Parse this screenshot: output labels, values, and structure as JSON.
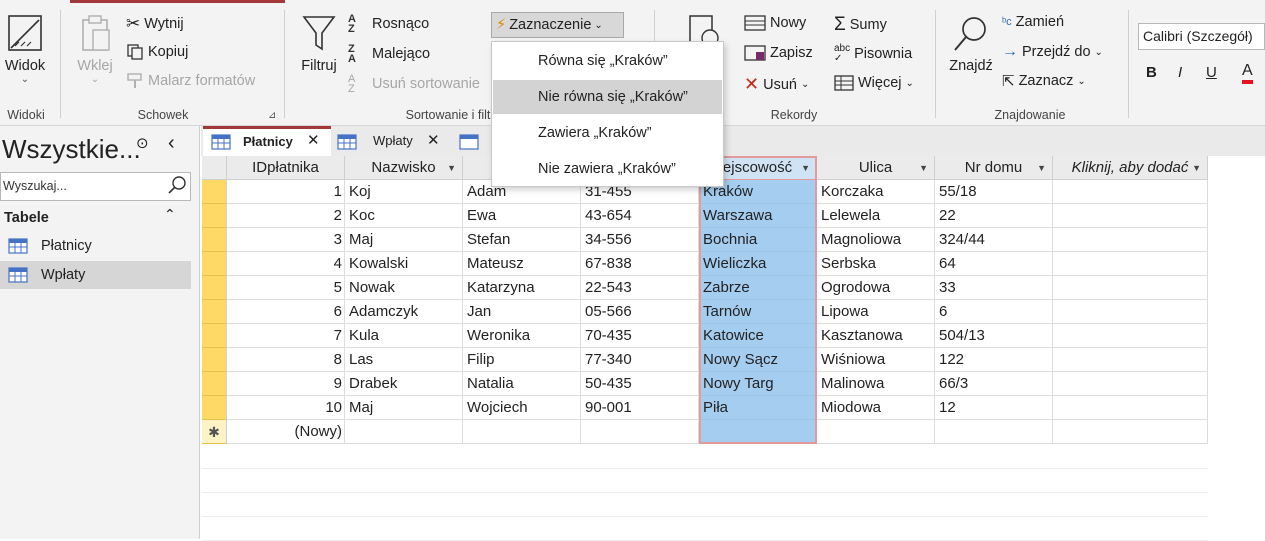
{
  "ribbon": {
    "widoki": {
      "label": "Widok",
      "group": "Widoki"
    },
    "schowek": {
      "paste": "Wklej",
      "cut": "Wytnij",
      "copy": "Kopiuj",
      "format_painter": "Malarz formatów",
      "group": "Schowek"
    },
    "sort": {
      "filter": "Filtruj",
      "asc": "Rosnąco",
      "desc": "Malejąco",
      "remove": "Usuń sortowanie",
      "selection": "Zaznaczenie",
      "group": "Sortowanie i filt"
    },
    "records": {
      "new": "Nowy",
      "save": "Zapisz",
      "delete": "Usuń",
      "totals": "Sumy",
      "spelling": "Pisownia",
      "more": "Więcej",
      "group": "Rekordy"
    },
    "find": {
      "find": "Znajdź",
      "replace": "Zamień",
      "goto": "Przejdź do",
      "select": "Zaznacz",
      "group": "Znajdowanie"
    },
    "font": {
      "name": "Calibri (Szczegół)",
      "bold": "B",
      "italic": "I",
      "underline": "U",
      "color": "A"
    }
  },
  "dropdown": {
    "items": [
      "Równa się „Kraków”",
      "Nie równa się „Kraków”",
      "Zawiera „Kraków”",
      "Nie zawiera „Kraków”"
    ]
  },
  "nav": {
    "title": "Wszystkie...",
    "search_placeholder": "Wyszukaj...",
    "section": "Tabele",
    "items": [
      "Płatnicy",
      "Wpłaty"
    ]
  },
  "tabs": [
    "Płatnicy",
    "Wpłaty"
  ],
  "table": {
    "headers": [
      "IDpłatnika",
      "Nazwisko",
      "",
      "",
      "ejscowość",
      "Ulica",
      "Nr domu",
      "Kliknij, aby dodać"
    ],
    "rows": [
      [
        "1",
        "Koj",
        "Adam",
        "31-455",
        "Kraków",
        "Korczaka",
        "55/18"
      ],
      [
        "2",
        "Koc",
        "Ewa",
        "43-654",
        "Warszawa",
        "Lelewela",
        "22"
      ],
      [
        "3",
        "Maj",
        "Stefan",
        "34-556",
        "Bochnia",
        "Magnoliowa",
        "324/44"
      ],
      [
        "4",
        "Kowalski",
        "Mateusz",
        "67-838",
        "Wieliczka",
        "Serbska",
        "64"
      ],
      [
        "5",
        "Nowak",
        "Katarzyna",
        "22-543",
        "Zabrze",
        "Ogrodowa",
        "33"
      ],
      [
        "6",
        "Adamczyk",
        "Jan",
        "05-566",
        "Tarnów",
        "Lipowa",
        "6"
      ],
      [
        "7",
        "Kula",
        "Weronika",
        "70-435",
        "Katowice",
        "Kasztanowa",
        "504/13"
      ],
      [
        "8",
        "Las",
        "Filip",
        "77-340",
        "Nowy Sącz",
        "Wiśniowa",
        "122"
      ],
      [
        "9",
        "Drabek",
        "Natalia",
        "50-435",
        "Nowy Targ",
        "Malinowa",
        "66/3"
      ],
      [
        "10",
        "Maj",
        "Wojciech",
        "90-001",
        "Piła",
        "Miodowa",
        "12"
      ]
    ],
    "new_row": "(Nowy)",
    "new_marker": "✱"
  },
  "colors": {
    "accent": "#a4373a",
    "selection": "#a5cdef",
    "row_selector": "#ffd966"
  }
}
